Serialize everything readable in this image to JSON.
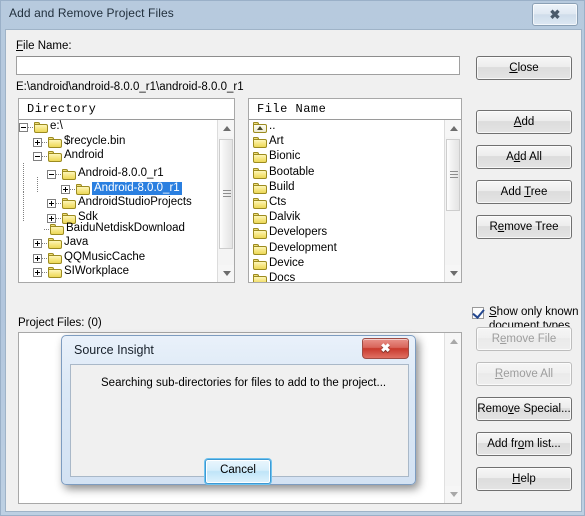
{
  "window": {
    "title": "Add and Remove Project Files",
    "close_glyph": "✖"
  },
  "form": {
    "filename_label": "File Name:",
    "filename_value": "",
    "filename_placeholder": "",
    "path": "E:\\android\\android-8.0.0_r1\\android-8.0.0_r1",
    "project_files_label": "Project Files: (0)"
  },
  "directory_panel": {
    "header": "Directory",
    "items": [
      {
        "label": "e:\\",
        "depth": 0,
        "toggle": "minus",
        "selected": false
      },
      {
        "label": "$recycle.bin",
        "depth": 1,
        "toggle": "plus",
        "selected": false
      },
      {
        "label": "Android",
        "depth": 1,
        "toggle": "minus",
        "selected": false
      },
      {
        "label": "Android-8.0.0_r1",
        "depth": 2,
        "toggle": "minus",
        "selected": false
      },
      {
        "label": "Android-8.0.0_r1",
        "depth": 3,
        "toggle": "plus",
        "selected": true
      },
      {
        "label": "AndroidStudioProjects",
        "depth": 2,
        "toggle": "plus",
        "selected": false
      },
      {
        "label": "Sdk",
        "depth": 2,
        "toggle": "plus",
        "selected": false
      },
      {
        "label": "BaiduNetdiskDownload",
        "depth": 1,
        "toggle": "none",
        "selected": false
      },
      {
        "label": "Java",
        "depth": 1,
        "toggle": "plus",
        "selected": false
      },
      {
        "label": "QQMusicCache",
        "depth": 1,
        "toggle": "plus",
        "selected": false
      },
      {
        "label": "SIWorkplace",
        "depth": 1,
        "toggle": "plus",
        "selected": false
      }
    ]
  },
  "file_panel": {
    "header": "File Name",
    "items": [
      {
        "label": "..",
        "icon": "folder-up"
      },
      {
        "label": "Art",
        "icon": "folder"
      },
      {
        "label": "Bionic",
        "icon": "folder"
      },
      {
        "label": "Bootable",
        "icon": "folder"
      },
      {
        "label": "Build",
        "icon": "folder"
      },
      {
        "label": "Cts",
        "icon": "folder"
      },
      {
        "label": "Dalvik",
        "icon": "folder"
      },
      {
        "label": "Developers",
        "icon": "folder"
      },
      {
        "label": "Development",
        "icon": "folder"
      },
      {
        "label": "Device",
        "icon": "folder"
      },
      {
        "label": "Docs",
        "icon": "folder"
      }
    ]
  },
  "buttons": {
    "close": "Close",
    "add": "Add",
    "add_all": "Add All",
    "add_tree": "Add Tree",
    "remove_tree": "Remove Tree",
    "remove_file": "Remove File",
    "remove_all": "Remove All",
    "remove_special": "Remove Special...",
    "add_from_list": "Add from list...",
    "help": "Help"
  },
  "checkbox": {
    "label": "Show only known document types",
    "checked": true
  },
  "modal": {
    "title": "Source Insight",
    "message": "Searching sub-directories for files to add to the project...",
    "cancel": "Cancel",
    "close_glyph": "✖"
  },
  "colors": {
    "titlebar": "#b2c6dd",
    "dialog_face": "#f0f0f0",
    "selection": "#2a7fe0",
    "modal_close_red": "#c8392c",
    "folder_yellow": "#f5e47e"
  }
}
